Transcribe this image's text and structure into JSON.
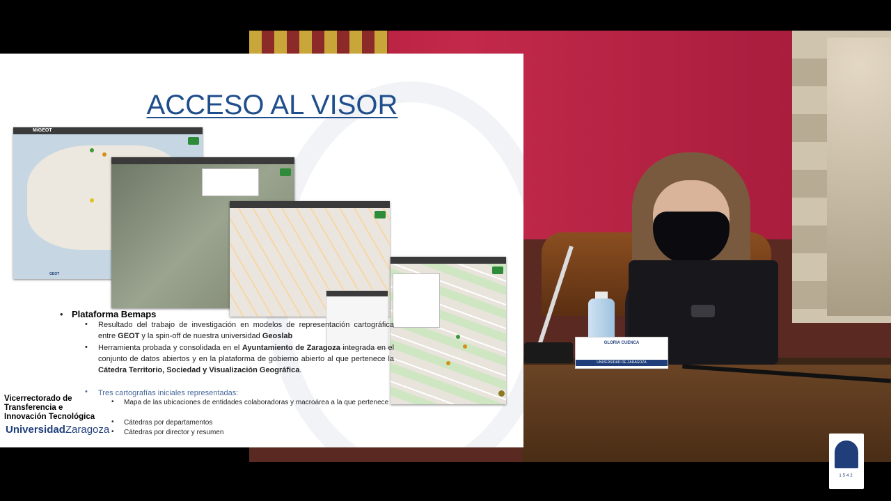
{
  "slide": {
    "title": "ACCESO AL VISOR",
    "bullet1": "Plataforma Bemaps",
    "b2_1": "Resultado del trabajo de investigación en modelos de representación cartográfica entre",
    "b2_1_bold1": "GEOT",
    "b2_1_mid": "y la spin-off de nuestra universidad",
    "b2_1_bold2": "Geoslab",
    "b2_2": "Herramienta probada y consolidada en el",
    "b2_2_bold": "Ayuntamiento de Zaragoza",
    "b2_2_mid": "integrada en el conjunto de datos abiertos y en la plataforma de gobierno abierto al que pertenece la",
    "b2_2_bold2": "Cátedra Territorio, Sociedad y Visualización Geográfica",
    "b2_2_end": ".",
    "b2_3": "Tres cartografías iniciales representadas:",
    "b3_1": "Mapa de las ubicaciones de entidades colaboradoras y macroárea a la que pertenece",
    "b3_2": "Cátedras por departamentos",
    "b3_3": "Cátedras por director y resumen",
    "org_line1": "Vicerrectorado de",
    "org_line2": "Transferencia e",
    "org_line3": "Innovación Tecnológica",
    "uni_part1": "Universidad",
    "uni_part2": "Zaragoza"
  },
  "screenshots": {
    "brand": "MiGEOT",
    "footer_brand": "GEOT"
  },
  "nameplate": {
    "name": "GLORIA CUENCA",
    "uni": "UNIVERSIDAD DE ZARAGOZA"
  },
  "corner_logo": {
    "year": "1542"
  },
  "colors": {
    "title_blue": "#1f4e8c",
    "uni_blue": "#1f3e7a",
    "curtain_red": "#b01a3a",
    "map_green": "#2e8b3a"
  }
}
